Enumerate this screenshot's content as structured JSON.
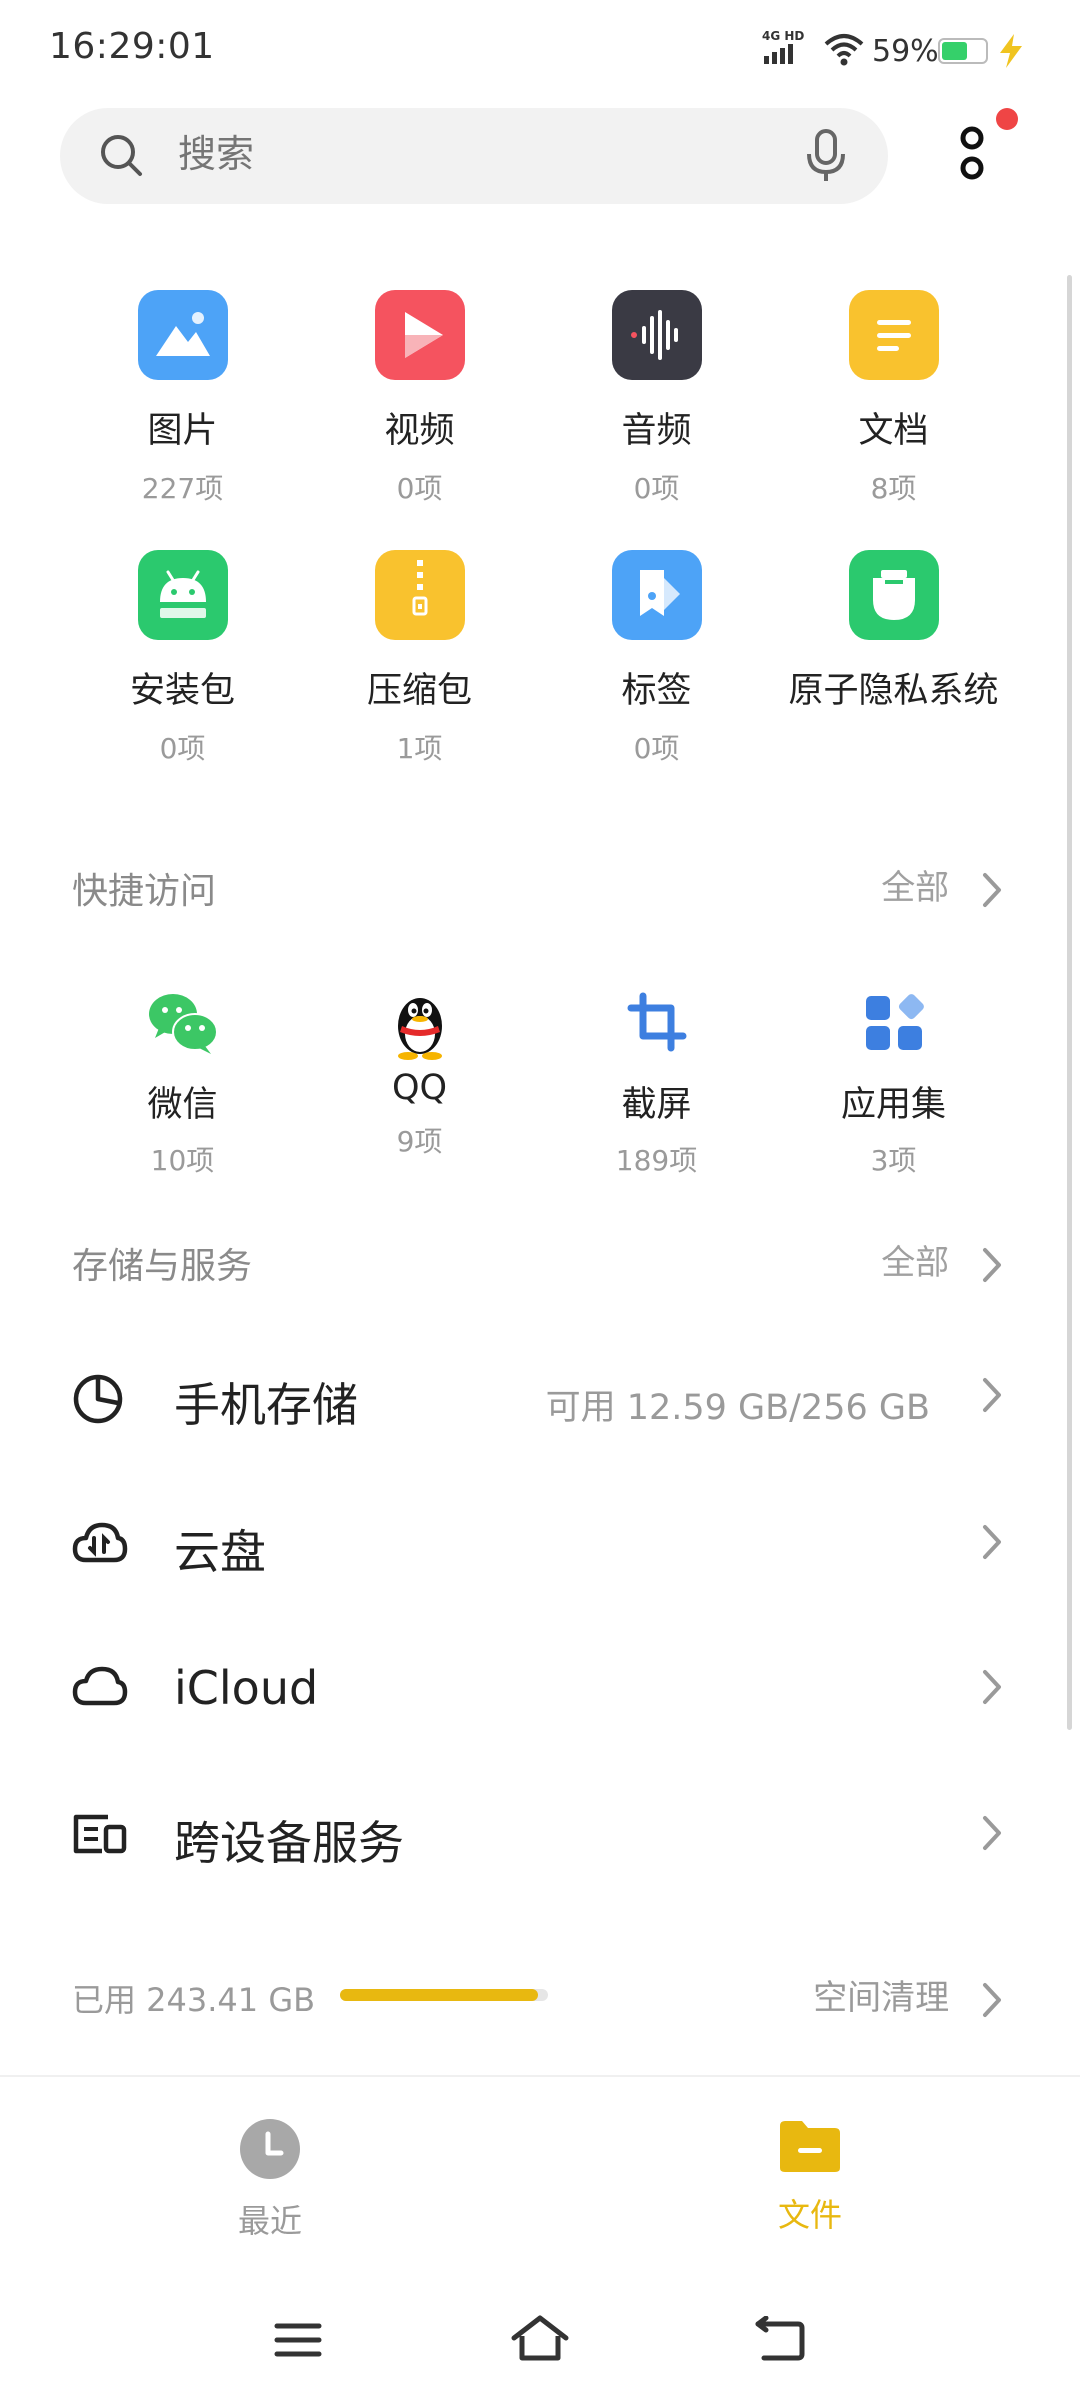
{
  "status_bar": {
    "time": "16:29:01",
    "network": "4G HD",
    "battery_percent": "59%",
    "battery_level": 0.59
  },
  "search": {
    "placeholder": "搜索"
  },
  "categories": [
    {
      "label": "图片",
      "count": "227项",
      "icon": "image-icon",
      "color": "#4da3f7"
    },
    {
      "label": "视频",
      "count": "0项",
      "icon": "video-play-icon",
      "color": "#f5535f"
    },
    {
      "label": "音频",
      "count": "0项",
      "icon": "audio-wave-icon",
      "color": "#3a3a44"
    },
    {
      "label": "文档",
      "count": "8项",
      "icon": "document-icon",
      "color": "#f9c22e"
    },
    {
      "label": "安装包",
      "count": "0项",
      "icon": "android-icon",
      "color": "#2bc96e"
    },
    {
      "label": "压缩包",
      "count": "1项",
      "icon": "zip-icon",
      "color": "#f9c22e"
    },
    {
      "label": "标签",
      "count": "0项",
      "icon": "tag-icon",
      "color": "#4da3f7"
    },
    {
      "label": "原子隐私系统",
      "count": "",
      "icon": "privacy-icon",
      "color": "#2bc96e"
    }
  ],
  "quick_access": {
    "title": "快捷访问",
    "all_label": "全部",
    "items": [
      {
        "label": "微信",
        "count": "10项",
        "icon": "wechat-icon"
      },
      {
        "label": "QQ",
        "count": "9项",
        "icon": "qq-icon"
      },
      {
        "label": "截屏",
        "count": "189项",
        "icon": "screenshot-crop-icon"
      },
      {
        "label": "应用集",
        "count": "3项",
        "icon": "apps-icon"
      }
    ]
  },
  "storage": {
    "title": "存储与服务",
    "all_label": "全部",
    "rows": [
      {
        "label": "手机存储",
        "info": "可用 12.59 GB/256 GB",
        "icon": "pie-chart-icon"
      },
      {
        "label": "云盘",
        "info": "",
        "icon": "cloud-sync-icon"
      },
      {
        "label": "iCloud",
        "info": "",
        "icon": "cloud-icon"
      },
      {
        "label": "跨设备服务",
        "info": "",
        "icon": "multi-device-icon"
      }
    ],
    "used_label": "已用 243.41 GB",
    "used_fraction": 0.95,
    "clean_label": "空间清理"
  },
  "bottom_tabs": [
    {
      "label": "最近",
      "active": false
    },
    {
      "label": "文件",
      "active": true
    }
  ],
  "colors": {
    "accent": "#e8b810",
    "progress": "#e8b810",
    "badge": "#ef4545"
  }
}
